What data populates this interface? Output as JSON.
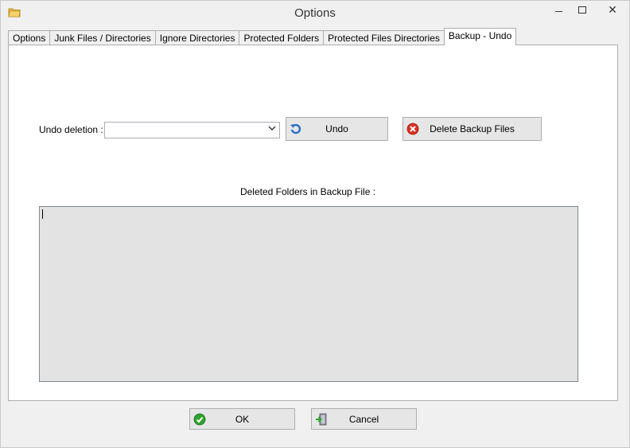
{
  "window": {
    "title": "Options",
    "controls": {
      "minimize": "minimize-icon",
      "maximize": "maximize-icon",
      "close": "close-icon"
    }
  },
  "tabs": [
    {
      "label": "Options",
      "active": false
    },
    {
      "label": "Junk Files / Directories",
      "active": false
    },
    {
      "label": "Ignore Directories",
      "active": false
    },
    {
      "label": "Protected Folders",
      "active": false
    },
    {
      "label": "Protected Files  Directories",
      "active": false
    },
    {
      "label": "Backup - Undo",
      "active": true
    }
  ],
  "backup_undo": {
    "undo_deletion_label": "Undo deletion :",
    "undo_deletion_value": "",
    "undo_button_label": "Undo",
    "delete_backup_button_label": "Delete Backup Files",
    "deleted_folders_label": "Deleted Folders in Backup File :",
    "deleted_folders_text": ""
  },
  "footer": {
    "ok_label": "OK",
    "cancel_label": "Cancel"
  },
  "colors": {
    "window_bg": "#f0f0f0",
    "panel_bg": "#ffffff",
    "textarea_bg": "#e3e3e3",
    "ok_icon": "#2ea32e",
    "delete_icon": "#d93025",
    "undo_icon": "#2a6fc9"
  }
}
